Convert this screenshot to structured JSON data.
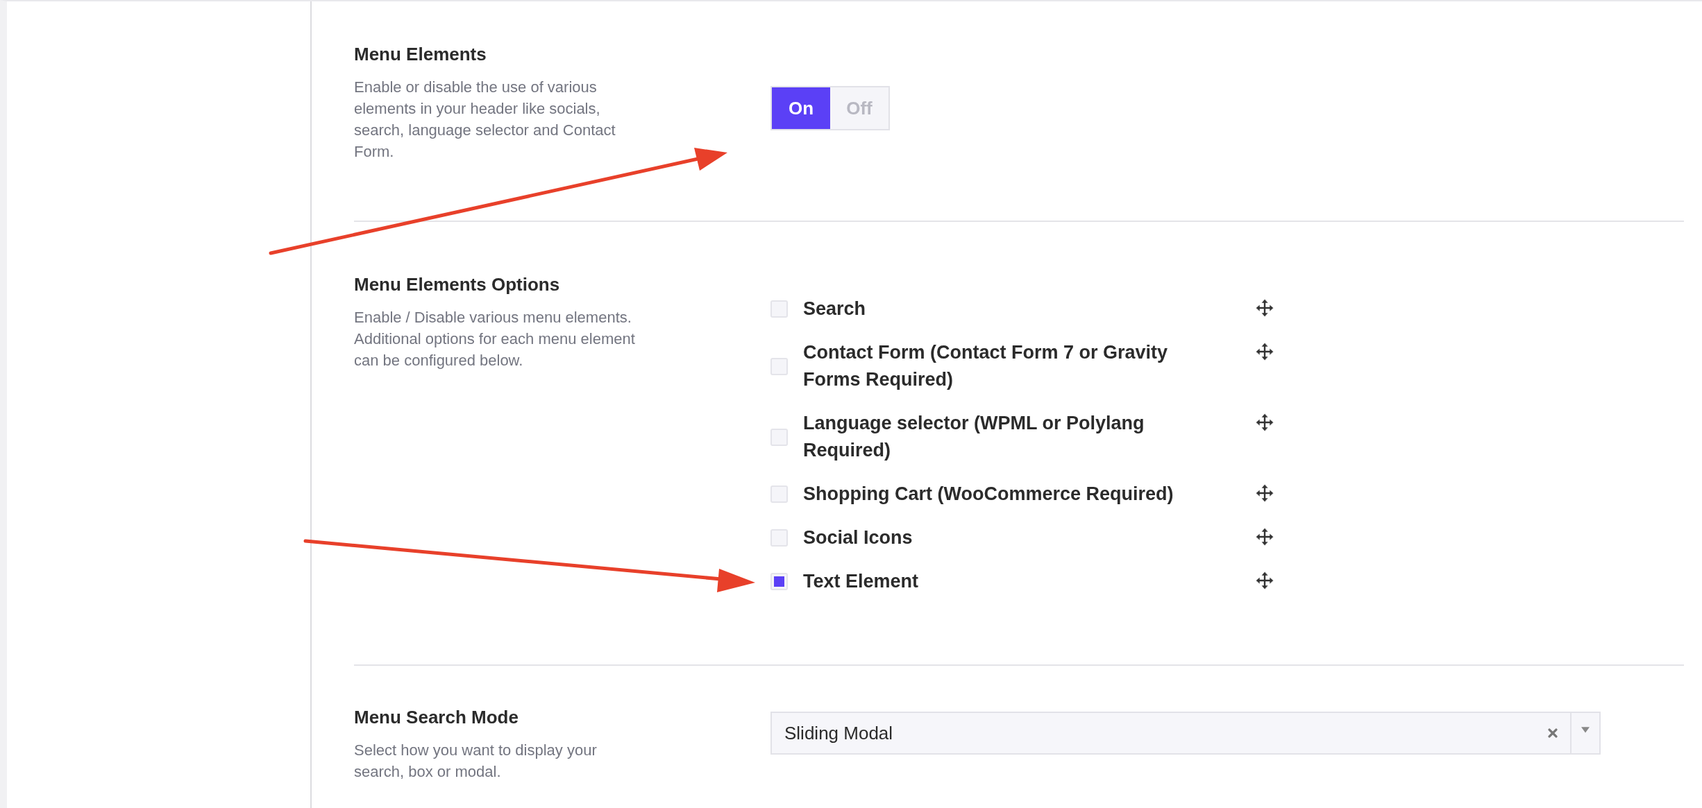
{
  "sections": [
    {
      "kind": "toggle",
      "title": "Menu Elements",
      "description": "Enable or disable the use of various elements in your header like socials, search, language selector and Contact Form.",
      "options": [
        {
          "label": "On",
          "selected": true
        },
        {
          "label": "Off",
          "selected": false
        }
      ]
    },
    {
      "kind": "checklist",
      "title": "Menu Elements Options",
      "description": "Enable / Disable various menu elements. Additional options for each menu element can be configured below.",
      "items": [
        {
          "label": "Search",
          "checked": false
        },
        {
          "label": "Contact Form (Contact Form 7 or Gravity Forms Required)",
          "checked": false
        },
        {
          "label": "Language selector (WPML or Polylang Required)",
          "checked": false
        },
        {
          "label": "Shopping Cart (WooCommerce Required)",
          "checked": false
        },
        {
          "label": "Social Icons",
          "checked": false
        },
        {
          "label": "Text Element",
          "checked": true
        }
      ]
    },
    {
      "kind": "select",
      "title": "Menu Search Mode",
      "description": "Select how you want to display your search, box or modal.",
      "value": "Sliding Modal"
    }
  ]
}
